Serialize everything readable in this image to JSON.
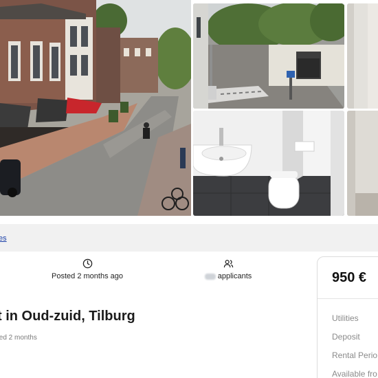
{
  "breadcrumb": {
    "link_text": "es"
  },
  "listing": {
    "posted": "Posted 2 months ago",
    "applicants_label": "applicants",
    "title": "t in Oud-zuid, Tilburg",
    "subline": "ted 2 months"
  },
  "price_card": {
    "price": "950 €",
    "rows": [
      "Utilities",
      "Deposit",
      "Rental Perio",
      "Available fro"
    ]
  },
  "icons": {
    "posted": "clock-icon",
    "applicants": "users-icon"
  },
  "colors": {
    "link": "#1a3fa8",
    "awning_red": "#c8262c",
    "bar_bg": "#f1f1f1"
  }
}
